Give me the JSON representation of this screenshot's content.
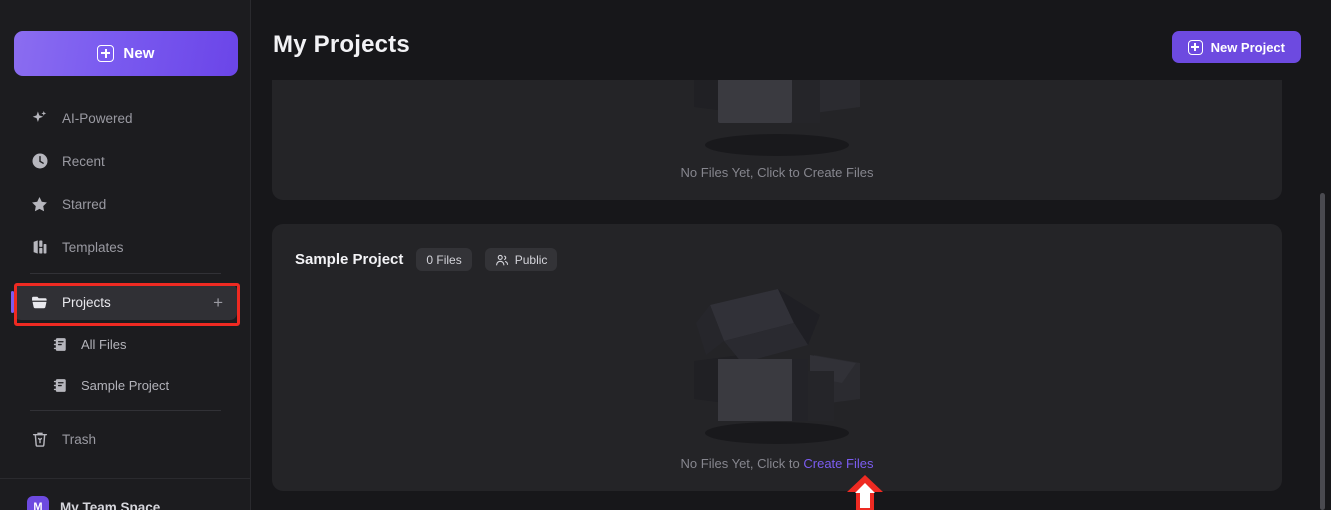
{
  "sidebar": {
    "new_button": {
      "label": "New",
      "icon": "plus-square-icon"
    },
    "items": [
      {
        "label": "AI-Powered",
        "icon": "sparkle-icon"
      },
      {
        "label": "Recent",
        "icon": "clock-icon"
      },
      {
        "label": "Starred",
        "icon": "star-icon"
      },
      {
        "label": "Templates",
        "icon": "templates-icon"
      }
    ],
    "projects": {
      "label": "Projects",
      "icon": "folder-icon",
      "action_icon": "plus-icon",
      "active": true
    },
    "sub_items": [
      {
        "label": "All Files",
        "icon": "notebook-icon"
      },
      {
        "label": "Sample Project",
        "icon": "notebook-icon"
      }
    ],
    "trash": {
      "label": "Trash",
      "icon": "trash-icon"
    },
    "team": {
      "label": "My Team Space",
      "avatar_initial": "M"
    }
  },
  "header": {
    "title": "My Projects",
    "new_project_button": {
      "label": "New Project",
      "icon": "plus-square-icon"
    }
  },
  "main": {
    "cards": [
      {
        "empty_text_prefix": "No Files Yet, Click to Create Files",
        "empty_link": ""
      },
      {
        "title": "Sample Project",
        "files_badge": "0 Files",
        "visibility_badge": {
          "label": "Public",
          "icon": "people-icon"
        },
        "empty_text_prefix": "No Files Yet, Click to ",
        "empty_link": "Create Files"
      }
    ]
  },
  "annotations": {
    "highlight_box": {
      "target": "Projects",
      "color": "#ee2a22"
    },
    "arrow": {
      "target": "Create Files",
      "color": "#ee2a22",
      "direction": "up"
    }
  },
  "colors": {
    "accent_purple": "#7b5cf0",
    "button_purple": "#6d4ae0",
    "background": "#17171a",
    "sidebar_bg": "#1c1c1f",
    "card_bg": "#242427",
    "annotation_red": "#ee2a22"
  }
}
